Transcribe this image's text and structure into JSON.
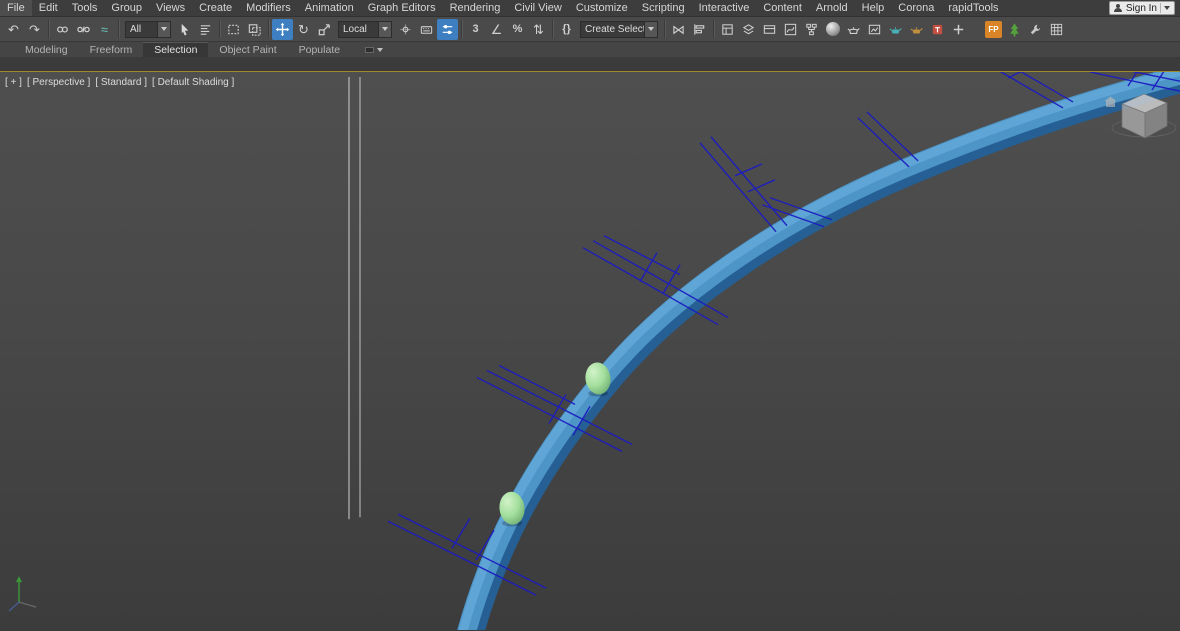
{
  "menubar": {
    "items": [
      "File",
      "Edit",
      "Tools",
      "Group",
      "Views",
      "Create",
      "Modifiers",
      "Animation",
      "Graph Editors",
      "Rendering",
      "Civil View",
      "Customize",
      "Scripting",
      "Interactive",
      "Content",
      "Arnold",
      "Help",
      "Corona",
      "rapidTools"
    ],
    "sign_in": "Sign In"
  },
  "toolbar": {
    "selection_filter_value": "All",
    "coord_system_value": "Local",
    "selection_set_value": "Create Selection Se",
    "snaps_label": "3",
    "percent_label": "%",
    "named_sets_label": "{}",
    "fp_label": "FP",
    "icons": [
      "undo",
      "redo",
      "select-and-link",
      "unlink-selection",
      "bind-to-space-warp",
      "selection-filter-dropdown",
      "select-object",
      "select-by-name",
      "rectangular-selection-region",
      "window-crossing-toggle",
      "select-and-move",
      "select-and-rotate",
      "select-and-scale",
      "reference-coordinate-system-dropdown",
      "use-center-flyout",
      "keyboard-shortcut-override",
      "select-and-manipulate",
      "snaps-toggle",
      "angle-snap-toggle",
      "percent-snap-toggle",
      "spinner-snap-toggle",
      "edit-named-selection-sets",
      "named-selection-sets-dropdown",
      "mirror",
      "align",
      "toggle-scene-explorer",
      "toggle-layer-explorer",
      "toggle-ribbon",
      "curve-editor",
      "schematic-view",
      "material-editor",
      "render-setup",
      "rendered-frame-window",
      "render-production",
      "render-activeshade",
      "render-texture",
      "add",
      "forest-pack",
      "tree-plugin",
      "wrench-tool",
      "grid-display"
    ]
  },
  "glyphs": {
    "undo": "↶",
    "redo": "↷",
    "bind": "≈",
    "rotate": "↻",
    "mirror": "⋈",
    "angle": "∠",
    "spinner": "⇅"
  },
  "ribbon": {
    "tabs": [
      "Modeling",
      "Freeform",
      "Selection",
      "Object Paint",
      "Populate"
    ],
    "active_tab": "Selection"
  },
  "viewport": {
    "label_segments": [
      "[ + ]",
      "[ Perspective ]",
      "[ Standard ]",
      "[ Default Shading ]"
    ],
    "scene_objects": [
      "road-spline",
      "marker-helpers",
      "egg-object-1",
      "egg-object-2",
      "vertical-spline-pair",
      "viewcube",
      "axis-tripod"
    ],
    "colors": {
      "road_light": "#4d95c7",
      "road_dark": "#255f93",
      "marker_blue": "#1c1cc0",
      "egg_green": "#a3df9d",
      "active_viewport_border": "#9f8b2d",
      "tool_active": "#3e7fc1"
    }
  }
}
